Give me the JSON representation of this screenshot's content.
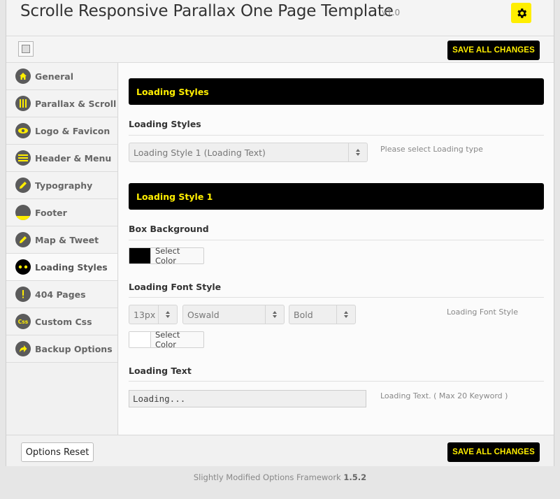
{
  "header": {
    "title": "Scrolle Responsive Parallax One Page Template",
    "version": "v1.0"
  },
  "toolbar": {
    "save_label": "SAVE ALL CHANGES"
  },
  "sidebar": {
    "items": [
      {
        "label": "General",
        "icon": "home-icon"
      },
      {
        "label": "Parallax & Scroll",
        "icon": "parallax-icon"
      },
      {
        "label": "Logo & Favicon",
        "icon": "eye-icon"
      },
      {
        "label": "Header & Menu",
        "icon": "menu-icon"
      },
      {
        "label": "Typography",
        "icon": "pencil-icon"
      },
      {
        "label": "Footer",
        "icon": "footer-icon"
      },
      {
        "label": "Map & Tweet",
        "icon": "pencil-icon"
      },
      {
        "label": "Loading Styles",
        "icon": "loading-dots-icon",
        "active": true
      },
      {
        "label": "404 Pages",
        "icon": "exclamation-icon"
      },
      {
        "label": "Custom Css",
        "icon": "css-icon"
      },
      {
        "label": "Backup Options",
        "icon": "share-arrow-icon"
      }
    ]
  },
  "main": {
    "section1_title": "Loading Styles",
    "loading_styles_label": "Loading Styles",
    "loading_style_select": "Loading Style 1 (Loading Text)",
    "loading_style_help": "Please select Loading type",
    "section2_title": "Loading Style 1",
    "box_background_label": "Box Background",
    "box_background_color": "#000000",
    "select_color_label": "Select Color",
    "font_style_label": "Loading Font Style",
    "font_size": "13px",
    "font_family": "Oswald",
    "font_weight": "Bold",
    "font_style_help": "Loading Font Style",
    "font_color": "#ffffff",
    "loading_text_label": "Loading Text",
    "loading_text_value": "Loading...",
    "loading_text_help": "Loading Text. ( Max 20 Keyword )"
  },
  "footer": {
    "reset_label": "Options Reset",
    "save_label": "SAVE ALL CHANGES"
  },
  "credit": {
    "text": "Slightly Modified Options Framework",
    "version": "1.5.2"
  },
  "colors": {
    "accent": "#ffee00",
    "bar": "#000000"
  }
}
